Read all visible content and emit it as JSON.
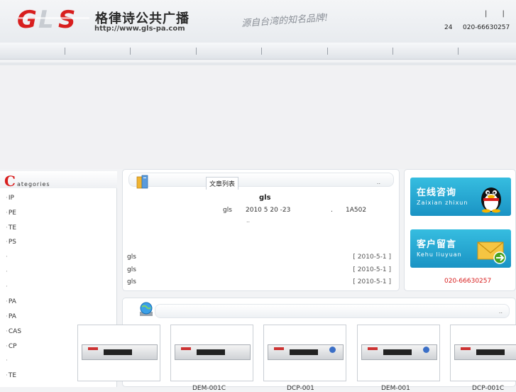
{
  "header": {
    "cn_title": "格律诗公共广播",
    "url": "http://www.gls-pa.com",
    "slogan": "源自台湾的知名品牌!",
    "bars": "| |",
    "hotline_label": "24",
    "hotline": "020-66630257"
  },
  "sidebar": {
    "title_c": "C",
    "title_rest": "ategories",
    "items": [
      "IP",
      "PE",
      "TE",
      "PS",
      "",
      "",
      "",
      "PA",
      "PA",
      "CAS",
      "CP",
      "",
      "TE"
    ]
  },
  "article": {
    "tab": "文章列表",
    "more": "..",
    "title": "gls",
    "meta_author": "gls",
    "meta_date": "2010 5 20 -23",
    "meta_dot": ".",
    "meta_room": "1A502",
    "dots": "..",
    "rows": [
      {
        "title": "gls",
        "date": "[ 2010-5-1 ]"
      },
      {
        "title": "gls",
        "date": "[ 2010-5-1 ]"
      },
      {
        "title": "gls",
        "date": "[ 2010-5-1 ]"
      }
    ]
  },
  "contact": {
    "online_cn": "在线咨询",
    "online_en": "Zaixian zhixun",
    "message_cn": "客户留言",
    "message_en": "Kehu liuyuan",
    "phone": "020-66630257"
  },
  "products": {
    "more": "..",
    "names": [
      "",
      "DEM-001C",
      "DCP-001",
      "DEM-001",
      "DCP-001C"
    ]
  },
  "colors": {
    "accent_red": "#d81e1e",
    "qq_blue": "#1a93c4",
    "msg_green": "#4aa31f"
  }
}
